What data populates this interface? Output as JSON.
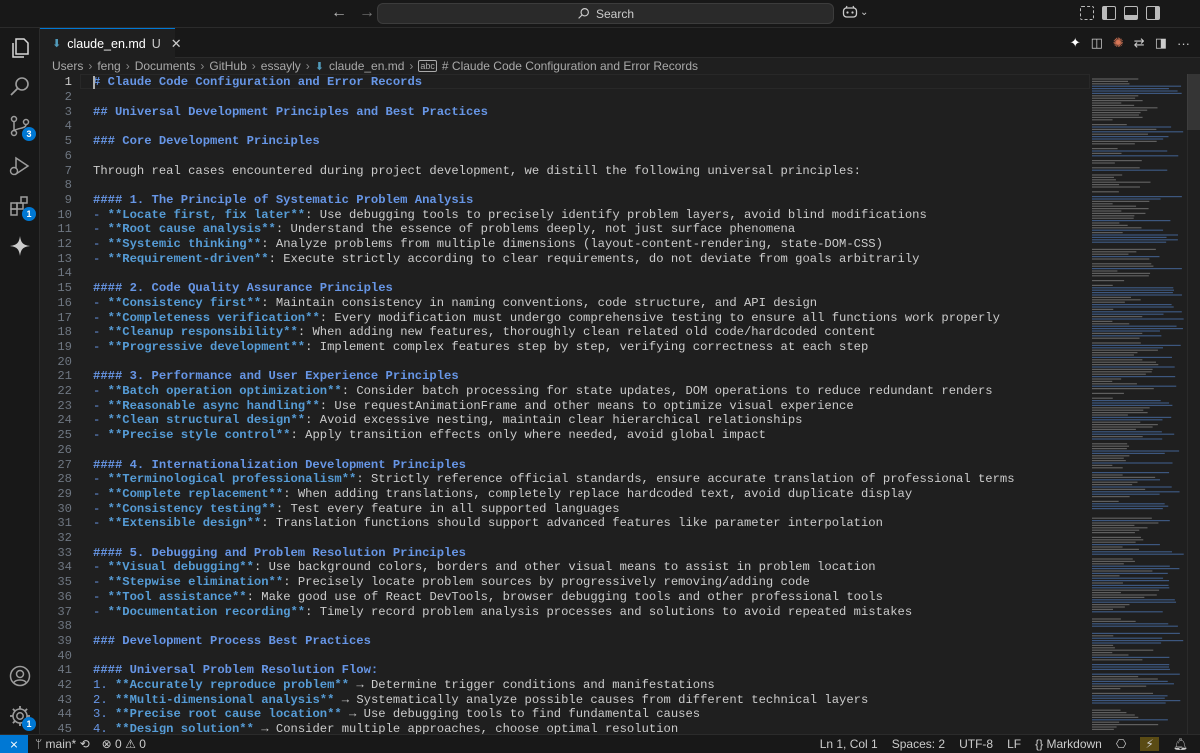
{
  "titlebar": {
    "search_label": "Search"
  },
  "activity_bar": {
    "source_control_badge": "3",
    "extensions_badge": "1",
    "manage_badge": "1"
  },
  "tab": {
    "filename": "claude_en.md",
    "modified_flag": "U",
    "close_glyph": "✕"
  },
  "breadcrumb": {
    "items": [
      "Users",
      "feng",
      "Documents",
      "GitHub",
      "essayly",
      "claude_en.md",
      "# Claude Code Configuration and Error Records"
    ]
  },
  "editor": {
    "lines": [
      {
        "n": "1",
        "t": "# Claude Code Configuration and Error Records",
        "k": "h"
      },
      {
        "n": "2",
        "t": "",
        "k": "p"
      },
      {
        "n": "3",
        "t": "## Universal Development Principles and Best Practices",
        "k": "h"
      },
      {
        "n": "4",
        "t": "",
        "k": "p"
      },
      {
        "n": "5",
        "t": "### Core Development Principles",
        "k": "h"
      },
      {
        "n": "6",
        "t": "",
        "k": "p"
      },
      {
        "n": "7",
        "t": "Through real cases encountered during project development, we distill the following universal principles:",
        "k": "p"
      },
      {
        "n": "8",
        "t": "",
        "k": "p"
      },
      {
        "n": "9",
        "t": "#### 1. The Principle of Systematic Problem Analysis",
        "k": "h"
      },
      {
        "n": "10",
        "b": "**Locate first, fix later**",
        "r": ": Use debugging tools to precisely identify problem layers, avoid blind modifications",
        "k": "li"
      },
      {
        "n": "11",
        "b": "**Root cause analysis**",
        "r": ": Understand the essence of problems deeply, not just surface phenomena",
        "k": "li"
      },
      {
        "n": "12",
        "b": "**Systemic thinking**",
        "r": ": Analyze problems from multiple dimensions (layout-content-rendering, state-DOM-CSS)",
        "k": "li"
      },
      {
        "n": "13",
        "b": "**Requirement-driven**",
        "r": ": Execute strictly according to clear requirements, do not deviate from goals arbitrarily",
        "k": "li"
      },
      {
        "n": "14",
        "t": "",
        "k": "p"
      },
      {
        "n": "15",
        "t": "#### 2. Code Quality Assurance Principles",
        "k": "h"
      },
      {
        "n": "16",
        "b": "**Consistency first**",
        "r": ": Maintain consistency in naming conventions, code structure, and API design",
        "k": "li"
      },
      {
        "n": "17",
        "b": "**Completeness verification**",
        "r": ": Every modification must undergo comprehensive testing to ensure all functions work properly",
        "k": "li"
      },
      {
        "n": "18",
        "b": "**Cleanup responsibility**",
        "r": ": When adding new features, thoroughly clean related old code/hardcoded content",
        "k": "li"
      },
      {
        "n": "19",
        "b": "**Progressive development**",
        "r": ": Implement complex features step by step, verifying correctness at each step",
        "k": "li"
      },
      {
        "n": "20",
        "t": "",
        "k": "p"
      },
      {
        "n": "21",
        "t": "#### 3. Performance and User Experience Principles",
        "k": "h"
      },
      {
        "n": "22",
        "b": "**Batch operation optimization**",
        "r": ": Consider batch processing for state updates, DOM operations to reduce redundant renders",
        "k": "li"
      },
      {
        "n": "23",
        "b": "**Reasonable async handling**",
        "r": ": Use requestAnimationFrame and other means to optimize visual experience",
        "k": "li"
      },
      {
        "n": "24",
        "b": "**Clean structural design**",
        "r": ": Avoid excessive nesting, maintain clear hierarchical relationships",
        "k": "li"
      },
      {
        "n": "25",
        "b": "**Precise style control**",
        "r": ": Apply transition effects only where needed, avoid global impact",
        "k": "li"
      },
      {
        "n": "26",
        "t": "",
        "k": "p"
      },
      {
        "n": "27",
        "t": "#### 4. Internationalization Development Principles",
        "k": "h"
      },
      {
        "n": "28",
        "b": "**Terminological professionalism**",
        "r": ": Strictly reference official standards, ensure accurate translation of professional terms",
        "k": "li"
      },
      {
        "n": "29",
        "b": "**Complete replacement**",
        "r": ": When adding translations, completely replace hardcoded text, avoid duplicate display",
        "k": "li"
      },
      {
        "n": "30",
        "b": "**Consistency testing**",
        "r": ": Test every feature in all supported languages",
        "k": "li"
      },
      {
        "n": "31",
        "b": "**Extensible design**",
        "r": ": Translation functions should support advanced features like parameter interpolation",
        "k": "li"
      },
      {
        "n": "32",
        "t": "",
        "k": "p"
      },
      {
        "n": "33",
        "t": "#### 5. Debugging and Problem Resolution Principles",
        "k": "h"
      },
      {
        "n": "34",
        "b": "**Visual debugging**",
        "r": ": Use background colors, borders and other visual means to assist in problem location",
        "k": "li"
      },
      {
        "n": "35",
        "b": "**Stepwise elimination**",
        "r": ": Precisely locate problem sources by progressively removing/adding code",
        "k": "li"
      },
      {
        "n": "36",
        "b": "**Tool assistance**",
        "r": ": Make good use of React DevTools, browser debugging tools and other professional tools",
        "k": "li"
      },
      {
        "n": "37",
        "b": "**Documentation recording**",
        "r": ": Timely record problem analysis processes and solutions to avoid repeated mistakes",
        "k": "li"
      },
      {
        "n": "38",
        "t": "",
        "k": "p"
      },
      {
        "n": "39",
        "t": "### Development Process Best Practices",
        "k": "h"
      },
      {
        "n": "40",
        "t": "",
        "k": "p"
      },
      {
        "n": "41",
        "t": "#### Universal Problem Resolution Flow:",
        "k": "h"
      },
      {
        "n": "42",
        "m": "1.",
        "b": "**Accurately reproduce problem**",
        "r": " → Determine trigger conditions and manifestations",
        "k": "ol"
      },
      {
        "n": "43",
        "m": "2.",
        "b": "**Multi-dimensional analysis**",
        "r": " → Systematically analyze possible causes from different technical layers",
        "k": "ol"
      },
      {
        "n": "44",
        "m": "3.",
        "b": "**Precise root cause location**",
        "r": " → Use debugging tools to find fundamental causes",
        "k": "ol"
      },
      {
        "n": "45",
        "m": "4.",
        "b": "**Design solution**",
        "r": " → Consider multiple approaches, choose optimal resolution",
        "k": "ol"
      }
    ]
  },
  "statusbar": {
    "branch": "main*",
    "errors": "0",
    "warnings": "0",
    "cursor_position": "Ln 1, Col 1",
    "indent": "Spaces: 2",
    "encoding": "UTF-8",
    "eol": "LF",
    "language": "Markdown"
  },
  "colors": {
    "accent": "#0078d4",
    "heading": "#6796e6",
    "bold": "#569cd6",
    "background": "#1f1f1f"
  }
}
